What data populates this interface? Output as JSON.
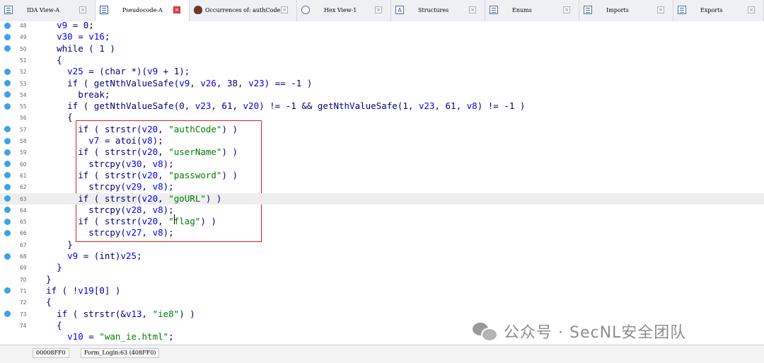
{
  "tabs": [
    {
      "label": "IDA View-A",
      "active": false,
      "icon": "ida-view-icon"
    },
    {
      "label": "Pseudocode-A",
      "active": true,
      "icon": "pseudocode-icon"
    },
    {
      "label": "Occurrences of: authCode",
      "active": false,
      "icon": "occurrences-icon"
    },
    {
      "label": "Hex View-1",
      "active": false,
      "icon": "hex-view-icon"
    },
    {
      "label": "Structures",
      "active": false,
      "icon": "structures-icon"
    },
    {
      "label": "Enums",
      "active": false,
      "icon": "enums-icon"
    },
    {
      "label": "Imports",
      "active": false,
      "icon": "imports-icon"
    },
    {
      "label": "Exports",
      "active": false,
      "icon": "exports-icon"
    }
  ],
  "close_glyph": "×",
  "lines": [
    {
      "no": "48",
      "dot": true,
      "indent": "  ",
      "tokens": [
        [
          "v",
          "v9"
        ],
        [
          "p",
          " = 0;"
        ]
      ]
    },
    {
      "no": "49",
      "dot": true,
      "indent": "  ",
      "tokens": [
        [
          "v",
          "v30"
        ],
        [
          "p",
          " = "
        ],
        [
          "v",
          "v16"
        ],
        [
          "p",
          ";"
        ]
      ]
    },
    {
      "no": "50",
      "dot": true,
      "indent": "  ",
      "tokens": [
        [
          "k",
          "while"
        ],
        [
          "p",
          " ( 1 )"
        ]
      ]
    },
    {
      "no": "51",
      "dot": false,
      "indent": "  ",
      "tokens": [
        [
          "p",
          "{"
        ]
      ]
    },
    {
      "no": "52",
      "dot": true,
      "indent": "    ",
      "tokens": [
        [
          "v",
          "v25"
        ],
        [
          "p",
          " = ("
        ],
        [
          "t",
          "char"
        ],
        [
          "p",
          " *)("
        ],
        [
          "v",
          "v9"
        ],
        [
          "p",
          " + 1);"
        ]
      ]
    },
    {
      "no": "53",
      "dot": true,
      "indent": "    ",
      "tokens": [
        [
          "k",
          "if"
        ],
        [
          "p",
          " ( "
        ],
        [
          "f",
          "getNthValueSafe"
        ],
        [
          "p",
          "("
        ],
        [
          "v",
          "v9"
        ],
        [
          "p",
          ", "
        ],
        [
          "v",
          "v26"
        ],
        [
          "p",
          ", 38, "
        ],
        [
          "v",
          "v23"
        ],
        [
          "p",
          ") == -1 )"
        ]
      ]
    },
    {
      "no": "54",
      "dot": true,
      "indent": "      ",
      "tokens": [
        [
          "k",
          "break"
        ],
        [
          "p",
          ";"
        ]
      ]
    },
    {
      "no": "55",
      "dot": true,
      "indent": "    ",
      "tokens": [
        [
          "k",
          "if"
        ],
        [
          "p",
          " ( "
        ],
        [
          "f",
          "getNthValueSafe"
        ],
        [
          "p",
          "(0, "
        ],
        [
          "v",
          "v23"
        ],
        [
          "p",
          ", 61, "
        ],
        [
          "v",
          "v20"
        ],
        [
          "p",
          ") != -1 && "
        ],
        [
          "f",
          "getNthValueSafe"
        ],
        [
          "p",
          "(1, "
        ],
        [
          "v",
          "v23"
        ],
        [
          "p",
          ", 61, "
        ],
        [
          "v",
          "v8"
        ],
        [
          "p",
          ") != -1 )"
        ]
      ]
    },
    {
      "no": "56",
      "dot": false,
      "indent": "    ",
      "tokens": [
        [
          "p",
          "{"
        ]
      ]
    },
    {
      "no": "57",
      "dot": true,
      "indent": "      ",
      "tokens": [
        [
          "k",
          "if"
        ],
        [
          "p",
          " ( "
        ],
        [
          "f",
          "strstr"
        ],
        [
          "p",
          "("
        ],
        [
          "v",
          "v20"
        ],
        [
          "p",
          ", "
        ],
        [
          "s",
          "\"authCode\""
        ],
        [
          "p",
          ") )"
        ]
      ]
    },
    {
      "no": "58",
      "dot": true,
      "indent": "        ",
      "tokens": [
        [
          "v",
          "v7"
        ],
        [
          "p",
          " = "
        ],
        [
          "f",
          "atoi"
        ],
        [
          "p",
          "("
        ],
        [
          "v",
          "v8"
        ],
        [
          "p",
          ");"
        ]
      ]
    },
    {
      "no": "59",
      "dot": true,
      "indent": "      ",
      "tokens": [
        [
          "k",
          "if"
        ],
        [
          "p",
          " ( "
        ],
        [
          "f",
          "strstr"
        ],
        [
          "p",
          "("
        ],
        [
          "v",
          "v20"
        ],
        [
          "p",
          ", "
        ],
        [
          "s",
          "\"userName\""
        ],
        [
          "p",
          ") )"
        ]
      ]
    },
    {
      "no": "60",
      "dot": true,
      "indent": "        ",
      "tokens": [
        [
          "f",
          "strcpy"
        ],
        [
          "p",
          "("
        ],
        [
          "v",
          "v30"
        ],
        [
          "p",
          ", "
        ],
        [
          "v",
          "v8"
        ],
        [
          "p",
          ");"
        ]
      ]
    },
    {
      "no": "61",
      "dot": true,
      "indent": "      ",
      "tokens": [
        [
          "k",
          "if"
        ],
        [
          "p",
          " ( "
        ],
        [
          "f",
          "strstr"
        ],
        [
          "p",
          "("
        ],
        [
          "v",
          "v20"
        ],
        [
          "p",
          ", "
        ],
        [
          "s",
          "\"password\""
        ],
        [
          "p",
          ") )"
        ]
      ]
    },
    {
      "no": "62",
      "dot": true,
      "indent": "        ",
      "tokens": [
        [
          "f",
          "strcpy"
        ],
        [
          "p",
          "("
        ],
        [
          "v",
          "v29"
        ],
        [
          "p",
          ", "
        ],
        [
          "v",
          "v8"
        ],
        [
          "p",
          ");"
        ]
      ]
    },
    {
      "no": "63",
      "dot": true,
      "indent": "      ",
      "hl": true,
      "tokens": [
        [
          "k",
          "if"
        ],
        [
          "p",
          " ( "
        ],
        [
          "f",
          "strstr"
        ],
        [
          "p",
          "("
        ],
        [
          "v",
          "v20"
        ],
        [
          "p",
          ", "
        ],
        [
          "s",
          "\"goURL\""
        ],
        [
          "p",
          ") )"
        ]
      ]
    },
    {
      "no": "64",
      "dot": true,
      "indent": "        ",
      "tokens": [
        [
          "f",
          "strcpy"
        ],
        [
          "p",
          "("
        ],
        [
          "v",
          "v28"
        ],
        [
          "p",
          ", "
        ],
        [
          "v",
          "v8"
        ],
        [
          "p",
          ");"
        ]
      ]
    },
    {
      "no": "65",
      "dot": true,
      "indent": "      ",
      "tokens": [
        [
          "k",
          "if"
        ],
        [
          "p",
          " ( "
        ],
        [
          "f",
          "strstr"
        ],
        [
          "p",
          "("
        ],
        [
          "v",
          "v20"
        ],
        [
          "p",
          ", "
        ],
        [
          "s",
          "\"flag\""
        ],
        [
          "p",
          ") )"
        ]
      ]
    },
    {
      "no": "66",
      "dot": true,
      "indent": "        ",
      "tokens": [
        [
          "f",
          "strcpy"
        ],
        [
          "p",
          "("
        ],
        [
          "v",
          "v27"
        ],
        [
          "p",
          ", "
        ],
        [
          "v",
          "v8"
        ],
        [
          "p",
          ");"
        ]
      ]
    },
    {
      "no": "67",
      "dot": false,
      "indent": "    ",
      "tokens": [
        [
          "p",
          "}"
        ]
      ]
    },
    {
      "no": "68",
      "dot": true,
      "indent": "    ",
      "tokens": [
        [
          "v",
          "v9"
        ],
        [
          "p",
          " = ("
        ],
        [
          "t",
          "int"
        ],
        [
          "p",
          ")"
        ],
        [
          "v",
          "v25"
        ],
        [
          "p",
          ";"
        ]
      ]
    },
    {
      "no": "69",
      "dot": false,
      "indent": "  ",
      "tokens": [
        [
          "p",
          "}"
        ]
      ]
    },
    {
      "no": "70",
      "dot": false,
      "indent": "",
      "tokens": [
        [
          "p",
          "}"
        ]
      ]
    },
    {
      "no": "71",
      "dot": true,
      "indent": "",
      "tokens": [
        [
          "k",
          "if"
        ],
        [
          "p",
          " ( !"
        ],
        [
          "v",
          "v19"
        ],
        [
          "p",
          "[0] )"
        ]
      ]
    },
    {
      "no": "72",
      "dot": false,
      "indent": "",
      "tokens": [
        [
          "p",
          "{"
        ]
      ]
    },
    {
      "no": "73",
      "dot": true,
      "indent": "  ",
      "tokens": [
        [
          "k",
          "if"
        ],
        [
          "p",
          " ( "
        ],
        [
          "f",
          "strstr"
        ],
        [
          "p",
          "(&"
        ],
        [
          "v",
          "v13"
        ],
        [
          "p",
          ", "
        ],
        [
          "s",
          "\"ie8\""
        ],
        [
          "p",
          ") )"
        ]
      ]
    },
    {
      "no": "74",
      "dot": false,
      "indent": "  ",
      "tokens": [
        [
          "p",
          "{"
        ]
      ]
    },
    {
      "no": "",
      "dot": false,
      "indent": "    ",
      "tokens": [
        [
          "v",
          "v10"
        ],
        [
          "p",
          " = "
        ],
        [
          "s",
          "\"wan_ie.html\""
        ],
        [
          "p",
          ";"
        ]
      ]
    }
  ],
  "status": {
    "address": "00008FF0",
    "location": "Form_Login:63 (408FF0)"
  },
  "watermark": "公众号 · SecNL安全团队",
  "colors": {
    "dot": "#3da2e8",
    "highlight_box": "#e02020",
    "active_tab_close": "#e24444"
  }
}
